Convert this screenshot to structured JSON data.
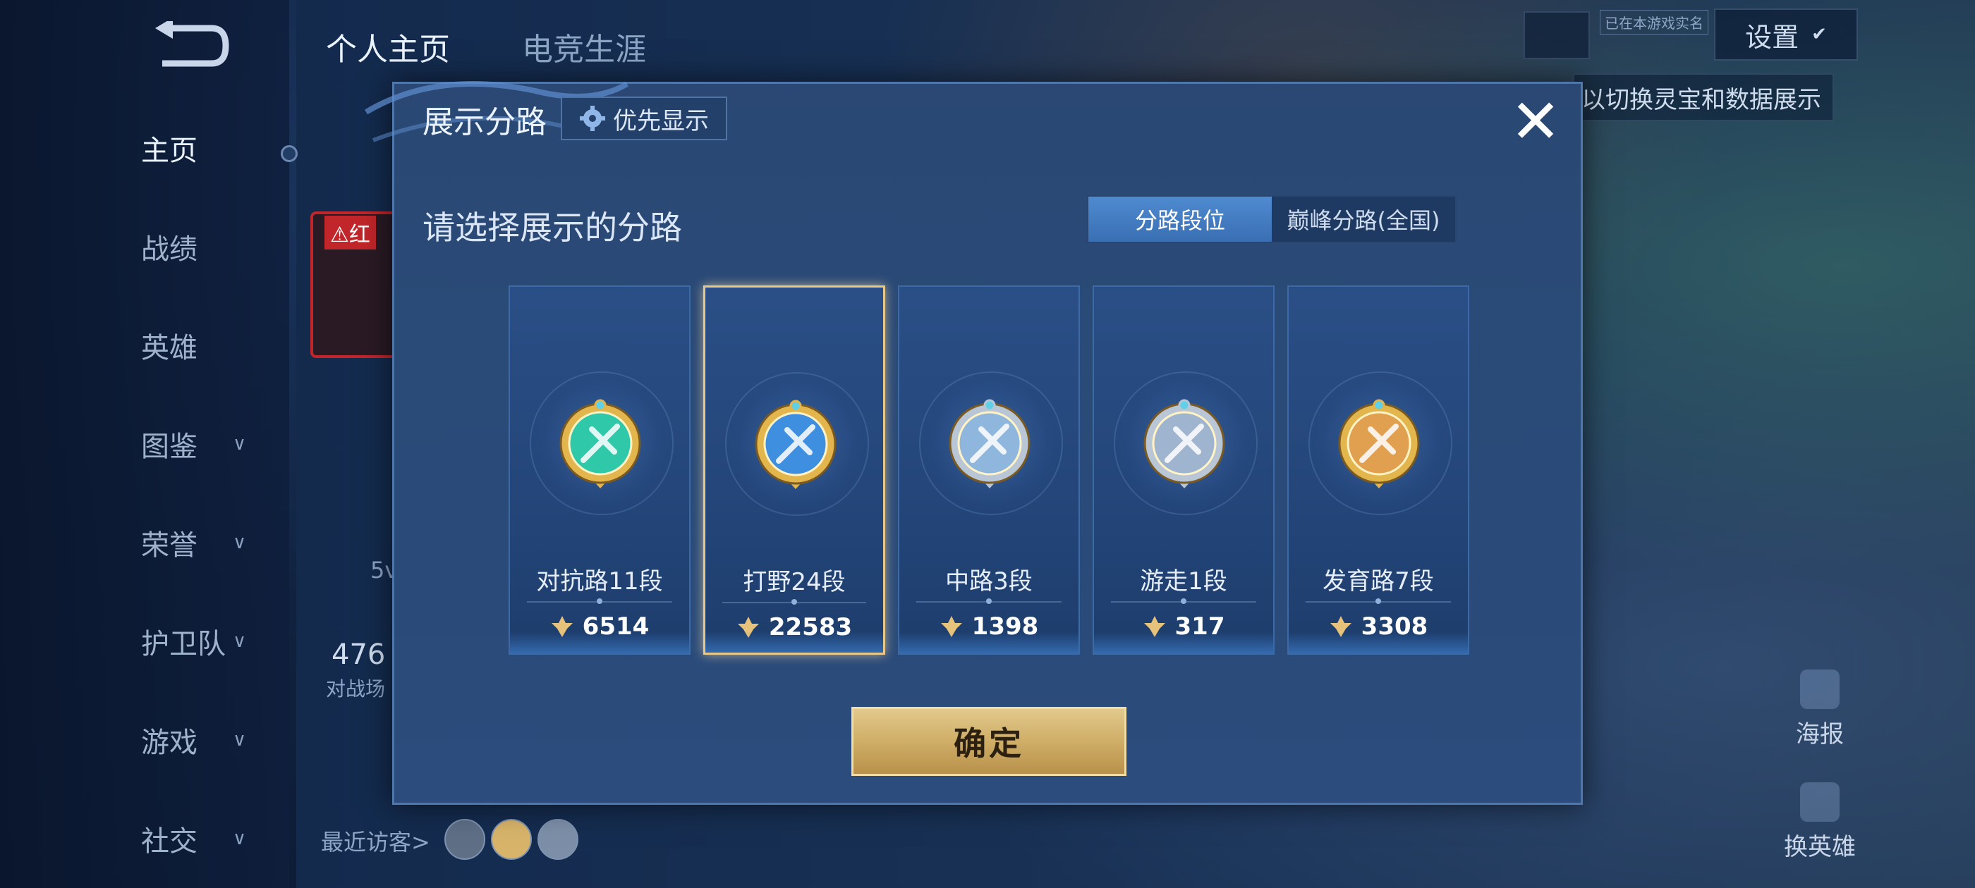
{
  "sidebar": {
    "items": [
      {
        "label": "主页",
        "chevron": false,
        "active": true
      },
      {
        "label": "战绩",
        "chevron": false
      },
      {
        "label": "英雄",
        "chevron": false
      },
      {
        "label": "图鉴",
        "chevron": true
      },
      {
        "label": "荣誉",
        "chevron": true
      },
      {
        "label": "护卫队",
        "chevron": true
      },
      {
        "label": "游戏",
        "chevron": true
      },
      {
        "label": "社交",
        "chevron": true
      }
    ]
  },
  "top_tabs": {
    "profile": "个人主页",
    "career": "电竞生涯"
  },
  "top_right": {
    "realname_badge": "已在本游戏实名",
    "settings": "设置",
    "hint": "以切换灵宝和数据展示"
  },
  "background_peek": {
    "red_label": "红",
    "stat_number": "476",
    "stat_sub": "对战场",
    "mode": "5v",
    "recent_visitors": "最近访客>"
  },
  "right_actions": {
    "poster": "海报",
    "swap_hero": "换英雄"
  },
  "modal": {
    "title": "展示分路",
    "priority_label": "优先显示",
    "subtitle": "请选择展示的分路",
    "segments": [
      "分路段位",
      "巅峰分路(全国)"
    ],
    "active_segment": 0,
    "confirm": "确定",
    "lanes": [
      {
        "rank": "对抗路11段",
        "score": "6514",
        "emblem": "clash-lane-emblem",
        "color": "#2fc8a8"
      },
      {
        "rank": "打野24段",
        "score": "22583",
        "emblem": "jungle-emblem",
        "color": "#3f8fe0"
      },
      {
        "rank": "中路3段",
        "score": "1398",
        "emblem": "mid-lane-emblem",
        "color": "#8fb6dc"
      },
      {
        "rank": "游走1段",
        "score": "317",
        "emblem": "roam-emblem",
        "color": "#9fb4cf"
      },
      {
        "rank": "发育路7段",
        "score": "3308",
        "emblem": "farm-lane-emblem",
        "color": "#e0a050"
      }
    ],
    "selected_lane": 1
  }
}
